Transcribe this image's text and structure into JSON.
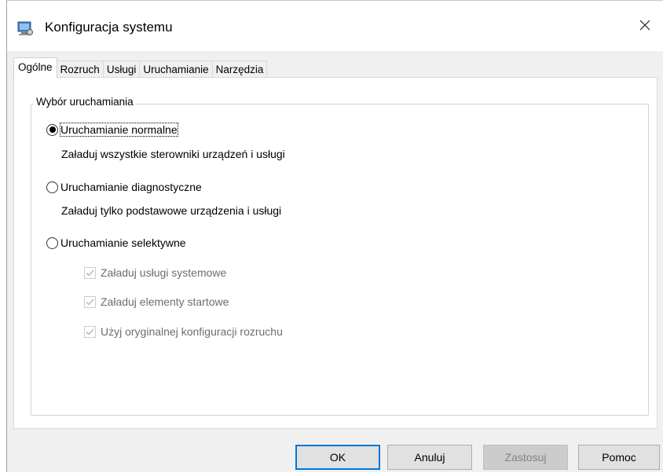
{
  "window": {
    "title": "Konfiguracja systemu",
    "icon": "msconfig-icon",
    "close_icon": "close-icon"
  },
  "tabs": [
    {
      "label": "Ogólne",
      "active": true
    },
    {
      "label": "Rozruch",
      "active": false
    },
    {
      "label": "Usługi",
      "active": false
    },
    {
      "label": "Uruchamianie",
      "active": false
    },
    {
      "label": "Narzędzia",
      "active": false
    }
  ],
  "startup_group": {
    "label": "Wybór uruchamiania",
    "options": [
      {
        "label": "Uruchamianie normalne",
        "description": "Załaduj wszystkie sterowniki urządzeń i usługi",
        "selected": true
      },
      {
        "label": "Uruchamianie diagnostyczne",
        "description": "Załaduj tylko podstawowe urządzenia i usługi",
        "selected": false
      },
      {
        "label": "Uruchamianie selektywne",
        "selected": false
      }
    ],
    "selective_options": [
      {
        "label": "Załaduj usługi systemowe",
        "checked": true,
        "disabled": true
      },
      {
        "label": "Załaduj elementy startowe",
        "checked": true,
        "disabled": true
      },
      {
        "label": "Użyj oryginalnej konfiguracji rozruchu",
        "checked": true,
        "disabled": true
      }
    ]
  },
  "buttons": {
    "ok": "OK",
    "cancel": "Anuluj",
    "apply": "Zastosuj",
    "help": "Pomoc"
  },
  "colors": {
    "accent": "#0078d7",
    "dialog_bg": "#f0f0f0",
    "disabled_text": "#6d6d6d"
  }
}
